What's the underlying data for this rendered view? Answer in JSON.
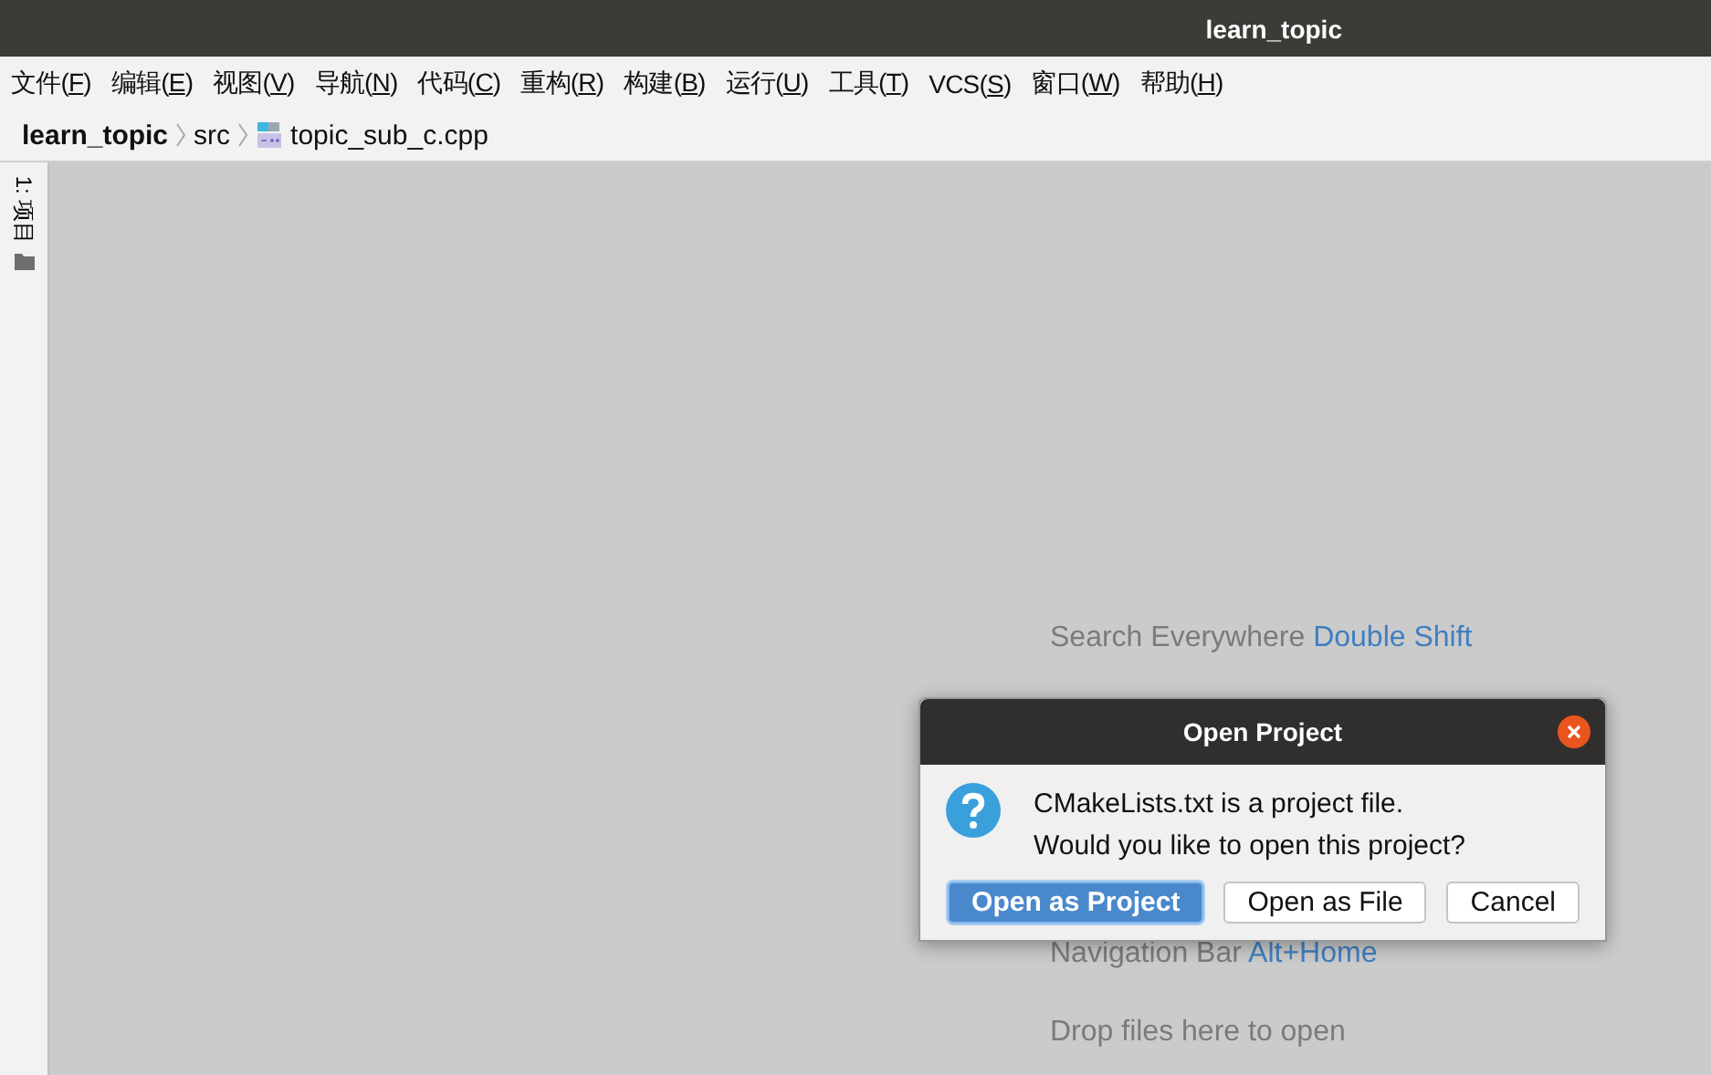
{
  "window": {
    "title": "learn_topic"
  },
  "menu": [
    {
      "prefix": "文件(",
      "key": "F",
      "suffix": ")"
    },
    {
      "prefix": "编辑(",
      "key": "E",
      "suffix": ")"
    },
    {
      "prefix": "视图(",
      "key": "V",
      "suffix": ")"
    },
    {
      "prefix": "导航(",
      "key": "N",
      "suffix": ")"
    },
    {
      "prefix": "代码(",
      "key": "C",
      "suffix": ")"
    },
    {
      "prefix": "重构(",
      "key": "R",
      "suffix": ")"
    },
    {
      "prefix": "构建(",
      "key": "B",
      "suffix": ")"
    },
    {
      "prefix": "运行(",
      "key": "U",
      "suffix": ")"
    },
    {
      "prefix": "工具(",
      "key": "T",
      "suffix": ")"
    },
    {
      "prefix": "VCS(",
      "key": "S",
      "suffix": ")"
    },
    {
      "prefix": "窗口(",
      "key": "W",
      "suffix": ")"
    },
    {
      "prefix": "帮助(",
      "key": "H",
      "suffix": ")"
    }
  ],
  "breadcrumb": [
    {
      "label": "learn_topic",
      "kind": "project"
    },
    {
      "label": "src",
      "kind": "folder"
    },
    {
      "label": "topic_sub_c.cpp",
      "kind": "file"
    }
  ],
  "tool_strip": {
    "label": "1: 项目"
  },
  "hints": [
    {
      "text": "Search Everywhere",
      "shortcut": "Double Shift"
    },
    {
      "text": "Navigation Bar",
      "shortcut": "Alt+Home"
    },
    {
      "text": "Drop files here to open"
    }
  ],
  "dialog": {
    "title": "Open Project",
    "message": [
      "CMakeLists.txt is a project file.",
      "Would you like to open this project?"
    ],
    "buttons": [
      {
        "label": "Open as Project",
        "default": true
      },
      {
        "label": "Open as File",
        "default": false
      },
      {
        "label": "Cancel",
        "default": false
      }
    ]
  }
}
